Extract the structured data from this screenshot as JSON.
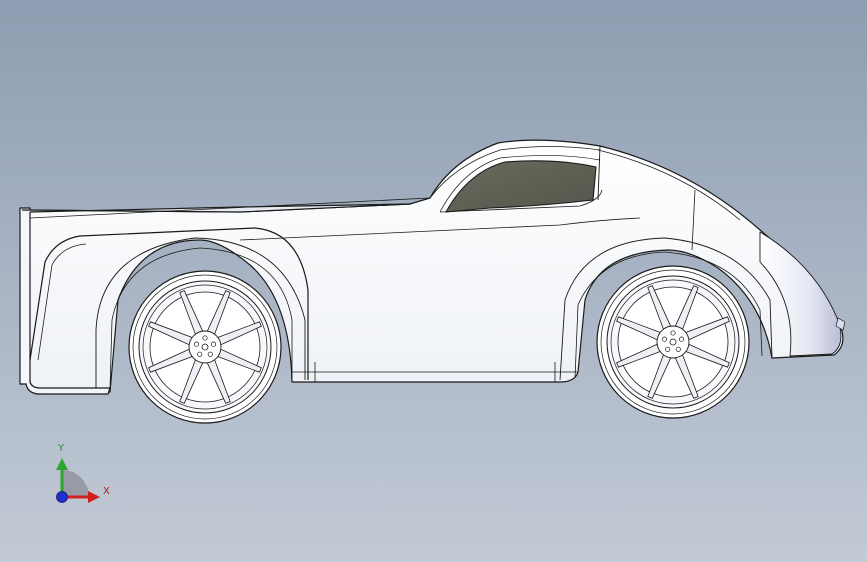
{
  "viewport": {
    "background_top": "#8e9db1",
    "background_bottom": "#c2cad5"
  },
  "model": {
    "body_color": "#ffffff",
    "edge_color": "#1a1a1a",
    "window_color": "#5e5d52"
  },
  "triad": {
    "y_label": "Y",
    "x_label": "X",
    "y_color": "#2fa52f",
    "x_color": "#d02020",
    "z_color": "#2030d0"
  }
}
